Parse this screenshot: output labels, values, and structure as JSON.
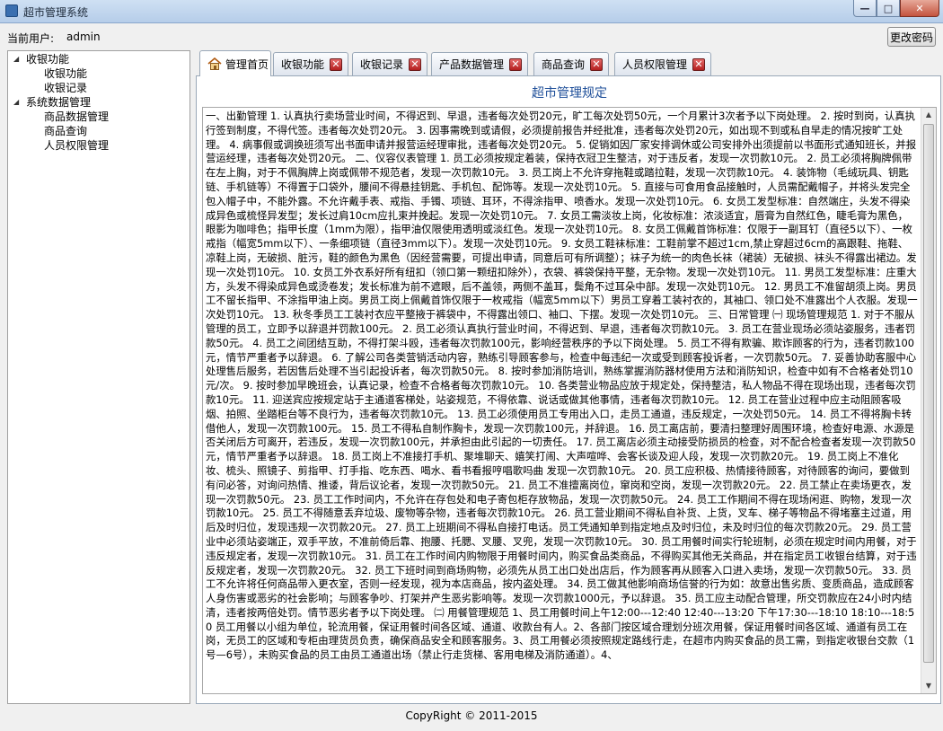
{
  "window": {
    "title": "超市管理系统",
    "min": "—",
    "max": "□",
    "close": "✕"
  },
  "userbar": {
    "label": "当前用户:",
    "username": "admin",
    "change_password": "更改密码"
  },
  "tree": [
    {
      "label": "收银功能",
      "children": [
        "收银功能",
        "收银记录"
      ]
    },
    {
      "label": "系统数据管理",
      "children": [
        "商品数据管理",
        "商品查询",
        "人员权限管理"
      ]
    }
  ],
  "tabs": [
    {
      "label": "管理首页"
    },
    {
      "label": "收银功能"
    },
    {
      "label": "收银记录"
    },
    {
      "label": "产品数据管理"
    },
    {
      "label": "商品查询"
    },
    {
      "label": "人员权限管理"
    }
  ],
  "main": {
    "heading": "超市管理规定",
    "text": "一、出勤管理 1. 认真执行卖场营业时间，不得迟到、早退，违者每次处罚20元，旷工每次处罚50元，一个月累计3次者予以下岗处理。 2. 按时到岗，认真执行签到制度，不得代签。违者每次处罚20元。 3. 因事需晚到或请假，必须提前报告并经批准，违者每次处罚20元，如出现不到或私自早走的情况按旷工处理。 4. 病事假或调换班须写出书面申请并报营运经理审批，违者每次处罚20元。 5. 促销如因厂家安排调休或公司安排外出须提前以书面形式通知班长，并报营运经理，违者每次处罚20元。 二、仪容仪表管理 1. 员工必须按规定着装，保持衣冠卫生整洁，对于违反者，发现一次罚款10元。 2. 员工必须将胸牌佩带在左上胸，对于不佩胸牌上岗或佩带不规范者，发现一次罚款10元。 3. 员工岗上不允许穿拖鞋或踏拉鞋，发现一次罚款10元。 4. 装饰物（毛绒玩具、钥匙链、手机链等）不得置于口袋外，腰间不得悬挂钥匙、手机包、配饰等。发现一次处罚10元。 5. 直接与可食用食品接触时，人员需配戴帽子，并将头发完全包入帽子中，不能外露。不允许戴手表、戒指、手镯、项链、耳环，不得涂指甲、喷香水。发现一次处罚10元。 6. 女员工发型标准：自然端庄，头发不得染成异色或梳怪异发型；发长过肩10cm应扎束并挽起。发现一次处罚10元。 7. 女员工需淡妆上岗，化妆标准：浓淡适宜，唇膏为自然红色，睫毛膏为黑色，眼影为咖啡色；指甲长度（1mm为限），指甲油仅限使用透明或淡红色。发现一次处罚10元。 8. 女员工佩戴首饰标准：仅限于一副耳钉（直径5以下）、一枚戒指（幅宽5mm以下）、一条细项链（直径3mm以下）。发现一次处罚10元。 9. 女员工鞋袜标准：工鞋前掌不超过1cm,禁止穿超过6cm的高跟鞋、拖鞋、凉鞋上岗，无破损、脏污，鞋的颜色为黑色（因经营需要，可提出申请，同意后可有所调整）；袜子为统一的肉色长袜（裙装）无破损、袜头不得露出裙边。发现一次处罚10元。 10. 女员工外衣系好所有纽扣（领口第一颗纽扣除外），衣袋、裤袋保持平整，无杂物。发现一次处罚10元。 11. 男员工发型标准：庄重大方，头发不得染成异色或烫卷发；发长标准为前不遮眼，后不盖领，两侧不盖耳，鬓角不过耳朵中部。发现一次处罚10元。 12. 男员工不准留胡须上岗。男员工不留长指甲、不涂指甲油上岗。男员工岗上佩戴首饰仅限于一枚戒指（幅宽5mm以下）男员工穿着工装衬衣的，其袖口、领口处不准露出个人衣服。发现一次处罚10元。 13. 秋冬季员工工装衬衣应平整掖于裤袋中，不得露出领口、袖口、下摆。发现一次处罚10元。 三、日常管理 ㈠ 现场管理规范 1. 对于不服从管理的员工，立即予以辞退并罚款100元。 2. 员工必须认真执行营业时间，不得迟到、早退，违者每次罚款10元。 3. 员工在营业现场必须站姿服务，违者罚款50元。 4. 员工之间团结互助，不得打架斗殴，违者每次罚款100元，影响经营秩序的予以下岗处理。 5. 员工不得有欺骗、欺诈顾客的行为，违者罚款100元，情节严重者予以辞退。 6. 了解公司各类营销活动内容，熟练引导顾客参与，检查中每违纪一次或受到顾客投诉者，一次罚款50元。 7. 妥善协助客服中心处理售后服务，若因售后处理不当引起投诉者，每次罚款50元。 8. 按时参加消防培训，熟练掌握消防器材使用方法和消防知识，检查中如有不合格者处罚10元/次。 9. 按时参加早晚班会，认真记录，检查不合格者每次罚款10元。 10. 各类营业物品应放于规定处，保持整洁，私人物品不得在现场出现，违者每次罚款10元。 11. 迎送宾应按规定站于主通道客梯处，站姿规范，不得依靠、说话或做其他事情，违者每次罚款10元。 12. 员工在营业过程中应主动阻顾客吸烟、拍照、坐踏柜台等不良行为，违者每次罚款10元。 13. 员工必须使用员工专用出入口，走员工通道，违反规定，一次处罚50元。 14. 员工不得将胸卡转借他人，发现一次罚款100元。 15. 员工不得私自制作胸卡，发现一次罚款100元，并辞退。 16. 员工离店前，要清扫整理好周围环境，检查好电源、水源是否关闭后方可离开，若违反，发现一次罚款100元，并承担由此引起的一切责任。 17. 员工离店必须主动接受防损员的检查，对不配合检查者发现一次罚款50元，情节严重者予以辞退。 18. 员工岗上不准接打手机、聚堆聊天、嬉笑打闹、大声喧哗、会客长谈及迎人段，发现一次罚款20元。 19. 员工岗上不准化妆、梳头、照镜子、剪指甲、打手指、吃东西、喝水、看书看报哼唱歌吗曲 发现一次罚款10元。 20. 员工应积极、热情接待顾客，对待顾客的询问，要做到有问必答，对询问热情、推诿，背后议论者，发现一次罚款50元。 21. 员工不准擅离岗位，窜岗和空岗，发现一次罚款20元。 22. 员工禁止在卖场更衣，发现一次罚款50元。 23. 员工工作时间内，不允许在存包处和电子寄包柜存放物品，发现一次罚款50元。 24. 员工工作期间不得在现场闲逛、购物，发现一次罚款10元。 25. 员工不得随意丢弃垃圾、废物等杂物，违者每次罚款10元。 26. 员工营业期间不得私自补货、上货，叉车、梯子等物品不得堵塞主过道，用后及时归位，发现违规一次罚款20元。 27. 员工上班期间不得私自接打电话。员工凭通知单到指定地点及时归位，未及时归位的每次罚款20元。 29. 员工营业中必须站姿端正，双手平放，不准前倚后靠、抱腰、托腮、叉腰、叉兜，发现一次罚款10元。 30. 员工用餐时间实行轮班制，必须在规定时间内用餐，对于违反规定者，发现一次罚款10元。 31. 员工在工作时间内购物限于用餐时间内，购买食品类商品，不得购买其他无关商品，并在指定员工收银台结算，对于违反规定者，发现一次罚款20元。 32. 员工下班时间到商场购物，必须先从员工出口处出店后，作为顾客再从顾客入口进入卖场，发现一次罚款50元。 33. 员工不允许将任何商品带入更衣室，否则一经发现，视为本店商品，按内盗处理。 34. 员工做其他影响商场信誉的行为如：故意出售劣质、变质商品，造成顾客人身伤害或恶劣的社会影响；与顾客争吵、打架并产生恶劣影响等。发现一次罚款1000元，予以辞退。 35. 员工应主动配合管理，所交罚款应在24小时内结清，违者按两倍处罚。情节恶劣者予以下岗处理。 ㈡ 用餐管理规范 1、员工用餐时间上午12:00---12:40 12:40---13:20 下午17:30---18:10 18:10---18:50 员工用餐以小组为单位，轮流用餐，保证用餐时间各区域、通道、收款台有人。2、各部门按区域合理划分班次用餐，保证用餐时间各区域、通道有员工在岗，无员工的区域和专柜由理货员负责，确保商品安全和顾客服务。3、员工用餐必须按照规定路线行走，在超市内购买食品的员工需，到指定收银台交款（1号—6号），未购买食品的员工由员工通道出场（禁止行走货梯、客用电梯及消防通道）。4、"
  },
  "footer": {
    "text": "CopyRight © 2011-2015"
  }
}
